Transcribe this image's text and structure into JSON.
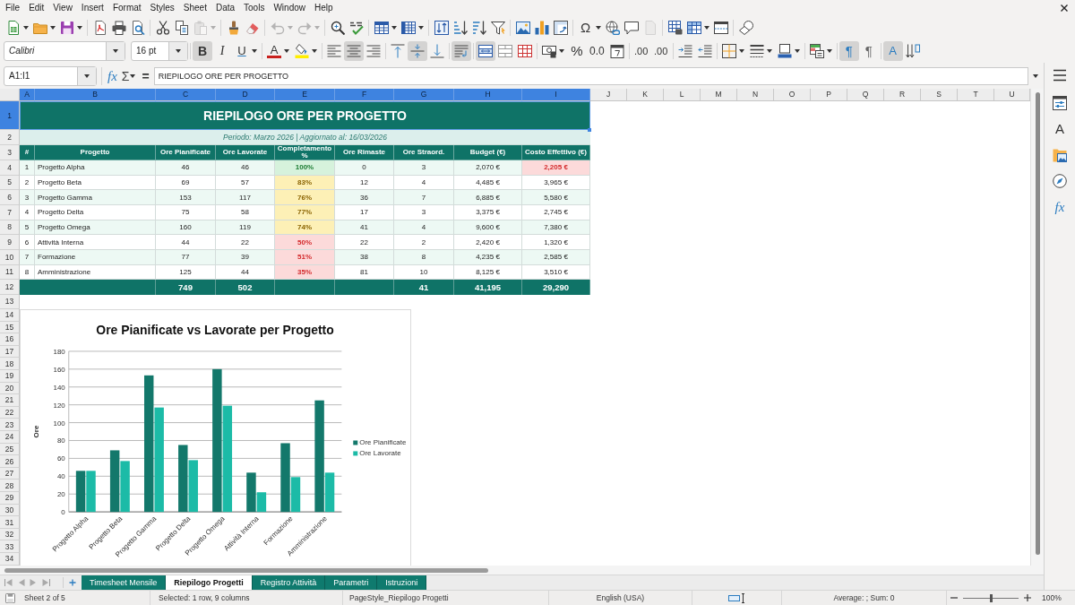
{
  "menu_bar": {
    "items": [
      "File",
      "Edit",
      "View",
      "Insert",
      "Format",
      "Styles",
      "Sheet",
      "Data",
      "Tools",
      "Window",
      "Help"
    ]
  },
  "standard_toolbar": {
    "groups": [
      {
        "buttons": [
          {
            "kind": "new",
            "dropdown": true,
            "disabled": false
          },
          {
            "kind": "open",
            "dropdown": true,
            "disabled": false
          },
          {
            "kind": "save",
            "dropdown": true,
            "disabled": false
          }
        ]
      },
      {
        "buttons": [
          {
            "kind": "pdf",
            "dropdown": false,
            "disabled": false
          },
          {
            "kind": "print",
            "dropdown": false,
            "disabled": false
          },
          {
            "kind": "preview",
            "dropdown": false,
            "disabled": false
          }
        ]
      },
      {
        "buttons": [
          {
            "kind": "cut",
            "dropdown": false,
            "disabled": false
          },
          {
            "kind": "copy",
            "dropdown": false,
            "disabled": false
          },
          {
            "kind": "paste",
            "dropdown": true,
            "disabled": true
          }
        ]
      },
      {
        "buttons": [
          {
            "kind": "clone",
            "dropdown": false,
            "disabled": false
          },
          {
            "kind": "clear",
            "dropdown": false,
            "disabled": false
          }
        ]
      },
      {
        "buttons": [
          {
            "kind": "undo",
            "dropdown": true,
            "disabled": true
          },
          {
            "kind": "redo",
            "dropdown": true,
            "disabled": true
          }
        ]
      },
      {
        "buttons": [
          {
            "kind": "find",
            "dropdown": false,
            "disabled": false
          },
          {
            "kind": "spelling",
            "dropdown": false,
            "disabled": false
          }
        ]
      },
      {
        "buttons": [
          {
            "kind": "rows",
            "dropdown": true,
            "disabled": false
          },
          {
            "kind": "columns",
            "dropdown": true,
            "disabled": false
          }
        ]
      },
      {
        "buttons": [
          {
            "kind": "sort",
            "dropdown": false,
            "disabled": false
          },
          {
            "kind": "ascending",
            "dropdown": false,
            "disabled": false
          },
          {
            "kind": "descending",
            "dropdown": false,
            "disabled": false
          },
          {
            "kind": "filter",
            "dropdown": false,
            "disabled": false
          }
        ]
      },
      {
        "buttons": [
          {
            "kind": "image",
            "dropdown": false,
            "disabled": false
          },
          {
            "kind": "chart",
            "dropdown": false,
            "disabled": false
          },
          {
            "kind": "pivot",
            "dropdown": false,
            "disabled": false
          }
        ]
      },
      {
        "buttons": [
          {
            "kind": "symbol",
            "glyph": "Ω",
            "dropdown": true,
            "disabled": false
          },
          {
            "kind": "link",
            "dropdown": false,
            "disabled": false
          },
          {
            "kind": "comment",
            "dropdown": false,
            "disabled": false
          },
          {
            "kind": "headers",
            "dropdown": false,
            "disabled": true
          }
        ]
      },
      {
        "buttons": [
          {
            "kind": "printarea",
            "dropdown": false,
            "disabled": false
          },
          {
            "kind": "freeze",
            "dropdown": true,
            "disabled": false
          },
          {
            "kind": "split",
            "dropdown": false,
            "disabled": false
          }
        ]
      },
      {
        "buttons": [
          {
            "kind": "shapes",
            "dropdown": false,
            "disabled": false
          }
        ]
      }
    ]
  },
  "formatting_toolbar": {
    "font_name": "Calibri",
    "font_size": "16 pt",
    "groups": [
      {
        "buttons": [
          {
            "kind": "bold",
            "glyph": "B",
            "on": true,
            "dropdown": false
          },
          {
            "kind": "italic",
            "glyph": "I",
            "on": false,
            "dropdown": false
          },
          {
            "kind": "underline",
            "glyph": "U",
            "on": false,
            "dropdown": true
          }
        ]
      },
      {
        "buttons": [
          {
            "kind": "fontcolor",
            "glyph": "A",
            "on": false,
            "dropdown": true
          },
          {
            "kind": "highlight",
            "on": false,
            "dropdown": true
          }
        ]
      },
      {
        "buttons": [
          {
            "kind": "left",
            "on": false,
            "dropdown": false
          },
          {
            "kind": "center",
            "on": true,
            "dropdown": false
          },
          {
            "kind": "right",
            "on": false,
            "dropdown": false
          }
        ]
      },
      {
        "buttons": [
          {
            "kind": "top",
            "on": false,
            "dropdown": false
          },
          {
            "kind": "middle",
            "on": true,
            "dropdown": false
          },
          {
            "kind": "bottom",
            "on": false,
            "dropdown": false
          }
        ]
      },
      {
        "buttons": [
          {
            "kind": "wrap",
            "on": true,
            "dropdown": false
          }
        ]
      },
      {
        "buttons": [
          {
            "kind": "mergecenter",
            "on": true,
            "dropdown": false
          },
          {
            "kind": "merge",
            "on": false,
            "dropdown": false
          },
          {
            "kind": "unmerge",
            "on": false,
            "dropdown": false
          }
        ]
      },
      {
        "buttons": [
          {
            "kind": "currency",
            "on": false,
            "dropdown": true
          },
          {
            "kind": "percent",
            "glyph": "%",
            "on": false,
            "dropdown": false
          },
          {
            "kind": "number",
            "glyph": "0.0",
            "on": false,
            "dropdown": false
          },
          {
            "kind": "date",
            "on": false,
            "dropdown": false
          }
        ]
      },
      {
        "buttons": [
          {
            "kind": "adddecimal",
            "glyph": ".00",
            "on": false,
            "dropdown": false
          },
          {
            "kind": "deldecimal",
            "glyph": ".00",
            "on": false,
            "dropdown": false
          }
        ]
      },
      {
        "buttons": [
          {
            "kind": "indent",
            "on": false,
            "dropdown": false
          },
          {
            "kind": "outdent",
            "on": false,
            "dropdown": false
          }
        ]
      },
      {
        "buttons": [
          {
            "kind": "borders",
            "on": false,
            "dropdown": true
          },
          {
            "kind": "borderstyle",
            "on": false,
            "dropdown": true
          },
          {
            "kind": "bordercolor",
            "on": false,
            "dropdown": true
          }
        ]
      },
      {
        "buttons": [
          {
            "kind": "conditional",
            "on": false,
            "dropdown": true
          }
        ]
      },
      {
        "buttons": [
          {
            "kind": "ltr",
            "glyph": "¶",
            "on": true,
            "dropdown": false
          },
          {
            "kind": "rtl",
            "glyph": "¶",
            "on": false,
            "dropdown": false
          }
        ]
      },
      {
        "buttons": [
          {
            "kind": "horizontal",
            "glyph": "A",
            "on": true,
            "dropdown": false
          },
          {
            "kind": "vertical",
            "on": false,
            "dropdown": false
          }
        ]
      }
    ]
  },
  "formula_bar": {
    "name_box": "A1:I1",
    "function_wizard": "fx",
    "sum": "Σ",
    "formula_sign": "=",
    "content": "RIEPILOGO ORE PER PROGETTO"
  },
  "sidebar": {
    "buttons": [
      {
        "kind": "menu"
      },
      {
        "kind": "properties"
      },
      {
        "kind": "styles",
        "glyph": "A"
      },
      {
        "kind": "gallery"
      },
      {
        "kind": "navigator"
      },
      {
        "kind": "functions",
        "glyph": "fx"
      }
    ]
  },
  "column_headers": [
    {
      "label": "A",
      "selected": true
    },
    {
      "label": "B",
      "selected": true
    },
    {
      "label": "C",
      "selected": true
    },
    {
      "label": "D",
      "selected": true
    },
    {
      "label": "E",
      "selected": true
    },
    {
      "label": "F",
      "selected": true
    },
    {
      "label": "G",
      "selected": true
    },
    {
      "label": "H",
      "selected": true
    },
    {
      "label": "I",
      "selected": true
    },
    {
      "label": "J",
      "selected": false
    },
    {
      "label": "K",
      "selected": false
    },
    {
      "label": "L",
      "selected": false
    },
    {
      "label": "M",
      "selected": false
    },
    {
      "label": "N",
      "selected": false
    },
    {
      "label": "O",
      "selected": false
    },
    {
      "label": "P",
      "selected": false
    },
    {
      "label": "Q",
      "selected": false
    },
    {
      "label": "R",
      "selected": false
    },
    {
      "label": "S",
      "selected": false
    },
    {
      "label": "T",
      "selected": false
    },
    {
      "label": "U",
      "selected": false
    }
  ],
  "row_headers": [
    {
      "label": "1",
      "selected": true
    },
    {
      "label": "2",
      "selected": false
    },
    {
      "label": "3",
      "selected": false
    },
    {
      "label": "4",
      "selected": false
    },
    {
      "label": "5",
      "selected": false
    },
    {
      "label": "6",
      "selected": false
    },
    {
      "label": "7",
      "selected": false
    },
    {
      "label": "8",
      "selected": false
    },
    {
      "label": "9",
      "selected": false
    },
    {
      "label": "10",
      "selected": false
    },
    {
      "label": "11",
      "selected": false
    },
    {
      "label": "12",
      "selected": false
    },
    {
      "label": "13",
      "selected": false
    },
    {
      "label": "14",
      "selected": false
    },
    {
      "label": "15",
      "selected": false
    },
    {
      "label": "16",
      "selected": false
    },
    {
      "label": "17",
      "selected": false
    },
    {
      "label": "18",
      "selected": false
    },
    {
      "label": "19",
      "selected": false
    },
    {
      "label": "20",
      "selected": false
    },
    {
      "label": "21",
      "selected": false
    },
    {
      "label": "22",
      "selected": false
    },
    {
      "label": "23",
      "selected": false
    },
    {
      "label": "24",
      "selected": false
    },
    {
      "label": "25",
      "selected": false
    },
    {
      "label": "26",
      "selected": false
    },
    {
      "label": "27",
      "selected": false
    },
    {
      "label": "28",
      "selected": false
    },
    {
      "label": "29",
      "selected": false
    },
    {
      "label": "30",
      "selected": false
    },
    {
      "label": "31",
      "selected": false
    },
    {
      "label": "32",
      "selected": false
    },
    {
      "label": "33",
      "selected": false
    },
    {
      "label": "34",
      "selected": false
    }
  ],
  "sheet": {
    "title": {
      "text": "RIEPILOGO ORE PER PROGETTO",
      "selected": true
    },
    "subtitle": "Periodo: Marzo 2026 | Aggiornato al: 16/03/2026",
    "table": {
      "columns": [
        "#",
        "Progetto",
        "Ore Pianificate",
        "Ore Lavorate",
        "Completamento %",
        "Ore Rimaste",
        "Ore Straord.",
        "Budget (€)",
        "Costo Effettivo (€)"
      ],
      "rows": [
        {
          "number": "1",
          "project": "Progetto Alpha",
          "planned": "46",
          "worked": "46",
          "completion": {
            "text": "100%",
            "kind": "good"
          },
          "remaining": "0",
          "overtime": "3",
          "budget": "2,070 €",
          "actual_cost": "2,205 €",
          "over_budget": true
        },
        {
          "number": "2",
          "project": "Progetto Beta",
          "planned": "69",
          "worked": "57",
          "completion": {
            "text": "83%",
            "kind": "fair"
          },
          "remaining": "12",
          "overtime": "4",
          "budget": "4,485 €",
          "actual_cost": "3,965 €",
          "over_budget": false
        },
        {
          "number": "3",
          "project": "Progetto Gamma",
          "planned": "153",
          "worked": "117",
          "completion": {
            "text": "76%",
            "kind": "fair"
          },
          "remaining": "36",
          "overtime": "7",
          "budget": "6,885 €",
          "actual_cost": "5,580 €",
          "over_budget": false
        },
        {
          "number": "4",
          "project": "Progetto Delta",
          "planned": "75",
          "worked": "58",
          "completion": {
            "text": "77%",
            "kind": "fair"
          },
          "remaining": "17",
          "overtime": "3",
          "budget": "3,375 €",
          "actual_cost": "2,745 €",
          "over_budget": false
        },
        {
          "number": "5",
          "project": "Progetto Omega",
          "planned": "160",
          "worked": "119",
          "completion": {
            "text": "74%",
            "kind": "fair"
          },
          "remaining": "41",
          "overtime": "4",
          "budget": "9,600 €",
          "actual_cost": "7,380 €",
          "over_budget": false
        },
        {
          "number": "6",
          "project": "Attività Interna",
          "planned": "44",
          "worked": "22",
          "completion": {
            "text": "50%",
            "kind": "poor"
          },
          "remaining": "22",
          "overtime": "2",
          "budget": "2,420 €",
          "actual_cost": "1,320 €",
          "over_budget": false
        },
        {
          "number": "7",
          "project": "Formazione",
          "planned": "77",
          "worked": "39",
          "completion": {
            "text": "51%",
            "kind": "poor"
          },
          "remaining": "38",
          "overtime": "8",
          "budget": "4,235 €",
          "actual_cost": "2,585 €",
          "over_budget": false
        },
        {
          "number": "8",
          "project": "Amministrazione",
          "planned": "125",
          "worked": "44",
          "completion": {
            "text": "35%",
            "kind": "poor"
          },
          "remaining": "81",
          "overtime": "10",
          "budget": "8,125 €",
          "actual_cost": "3,510 €",
          "over_budget": false
        }
      ],
      "totals": {
        "planned": "749",
        "worked": "502",
        "overtime": "41",
        "budget": "41,195",
        "actual_cost": "29,290"
      }
    }
  },
  "chart": {
    "chart_data": {
      "type": "bar",
      "title": "Ore Pianificate vs Lavorate per Progetto",
      "ylabel": "Ore",
      "categories": [
        "Progetto Alpha",
        "Progetto Beta",
        "Progetto Gamma",
        "Progetto Delta",
        "Progetto Omega",
        "Attività Interna",
        "Formazione",
        "Amministrazione"
      ],
      "series": [
        {
          "name": "Ore Pianificate",
          "color": "#13786b",
          "values": [
            46,
            69,
            153,
            75,
            160,
            44,
            77,
            125
          ]
        },
        {
          "name": "Ore Lavorate",
          "color": "#1cbba7",
          "values": [
            46,
            57,
            117,
            58,
            119,
            22,
            39,
            44
          ]
        }
      ],
      "ylim": [
        0,
        180
      ],
      "yticks": [
        {
          "value": 0,
          "label": "0"
        },
        {
          "value": 20,
          "label": "20"
        },
        {
          "value": 40,
          "label": "40"
        },
        {
          "value": 60,
          "label": "60"
        },
        {
          "value": 80,
          "label": "80"
        },
        {
          "value": 100,
          "label": "100"
        },
        {
          "value": 120,
          "label": "120"
        },
        {
          "value": 140,
          "label": "140"
        },
        {
          "value": 160,
          "label": "160"
        },
        {
          "value": 180,
          "label": "180"
        }
      ],
      "grid": true,
      "legend": true
    }
  },
  "sheet_tabs": [
    {
      "label": "Timesheet Mensile",
      "selected": false
    },
    {
      "label": "Riepilogo Progetti",
      "selected": true
    },
    {
      "label": "Registro Attività",
      "selected": false
    },
    {
      "label": "Parametri",
      "selected": false
    },
    {
      "label": "Istruzioni",
      "selected": false
    }
  ],
  "status_bar": {
    "sheet": "Sheet 2 of 5",
    "selection": "Selected: 1 row, 9 columns",
    "page_style": "PageStyle_Riepilogo Progetti",
    "language": "English (USA)",
    "summary": "Average: ; Sum: 0",
    "zoom_slider": {
      "level": 0.5
    },
    "zoom": "100%"
  }
}
